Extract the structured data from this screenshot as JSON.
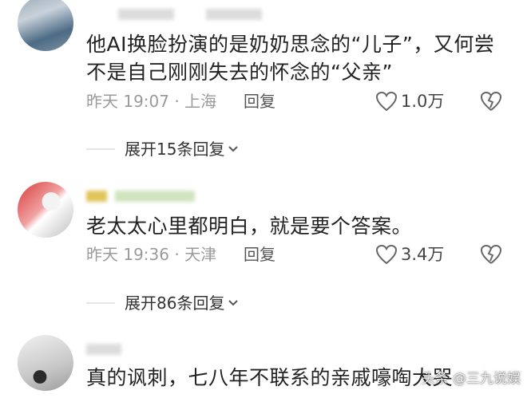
{
  "comments": [
    {
      "text": "他AI换脸扮演的是奶奶思念的“儿子”，又何尝不是自己刚刚失去的怀念的“父亲”",
      "time": "昨天 19:07 · 上海",
      "reply_label": "回复",
      "likes": "1.0万",
      "expand_label": "展开15条回复"
    },
    {
      "text": "老太太心里都明白，就是要个答案。",
      "time": "昨天 19:36 · 天津",
      "reply_label": "回复",
      "likes": "3.4万",
      "expand_label": "展开86条回复"
    },
    {
      "text": "真的讽刺，七八年不联系的亲戚嚎啕大哭"
    }
  ],
  "watermark": "头条 @三九说娱",
  "icons": {
    "like": "heart-outline-icon",
    "dislike": "broken-heart-icon",
    "expand": "chevron-down-icon"
  },
  "colors": {
    "text": "#222222",
    "meta": "#9a9a9a",
    "icon": "#666666"
  }
}
